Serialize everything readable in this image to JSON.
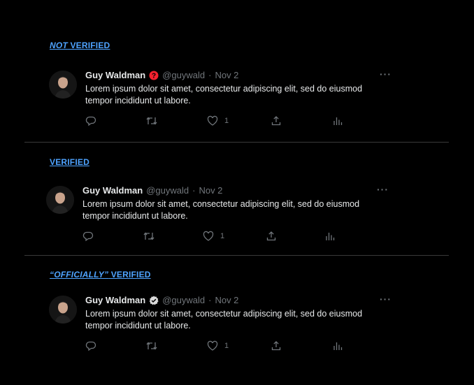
{
  "sections": [
    {
      "label_em": "NOT",
      "label_rest": " VERIFIED",
      "badge": "red-question-badge",
      "tweet": {
        "name": "Guy Waldman",
        "handle": "@guywald",
        "sep": "·",
        "date": "Nov 2",
        "more": "···",
        "text": "Lorem ipsum dolor sit amet, consectetur adipiscing elit, sed do eiusmod tempor incididunt ut labore.",
        "likes": "1"
      }
    },
    {
      "label_em": "",
      "label_rest": "VERIFIED",
      "badge": "",
      "tweet": {
        "name": "Guy Waldman",
        "handle": "@guywald",
        "sep": "·",
        "date": "Nov 2",
        "more": "···",
        "text": "Lorem ipsum dolor sit amet, consectetur adipiscing elit, sed do eiusmod tempor incididunt ut labore.",
        "likes": "1"
      }
    },
    {
      "label_em": "“OFFICIALLY”",
      "label_rest": " VERIFIED",
      "badge": "gray-check-badge",
      "tweet": {
        "name": "Guy Waldman",
        "handle": "@guywald",
        "sep": "·",
        "date": "Nov 2",
        "more": "···",
        "text": "Lorem ipsum dolor sit amet, consectetur adipiscing elit, sed do eiusmod tempor incididunt ut labore.",
        "likes": "1"
      }
    }
  ],
  "colors": {
    "background": "#000000",
    "label": "#4ea3ff",
    "text": "#e7e9ea",
    "muted": "#71767b",
    "red_badge": "#f4212e",
    "gray_badge": "#d9d9d9"
  }
}
